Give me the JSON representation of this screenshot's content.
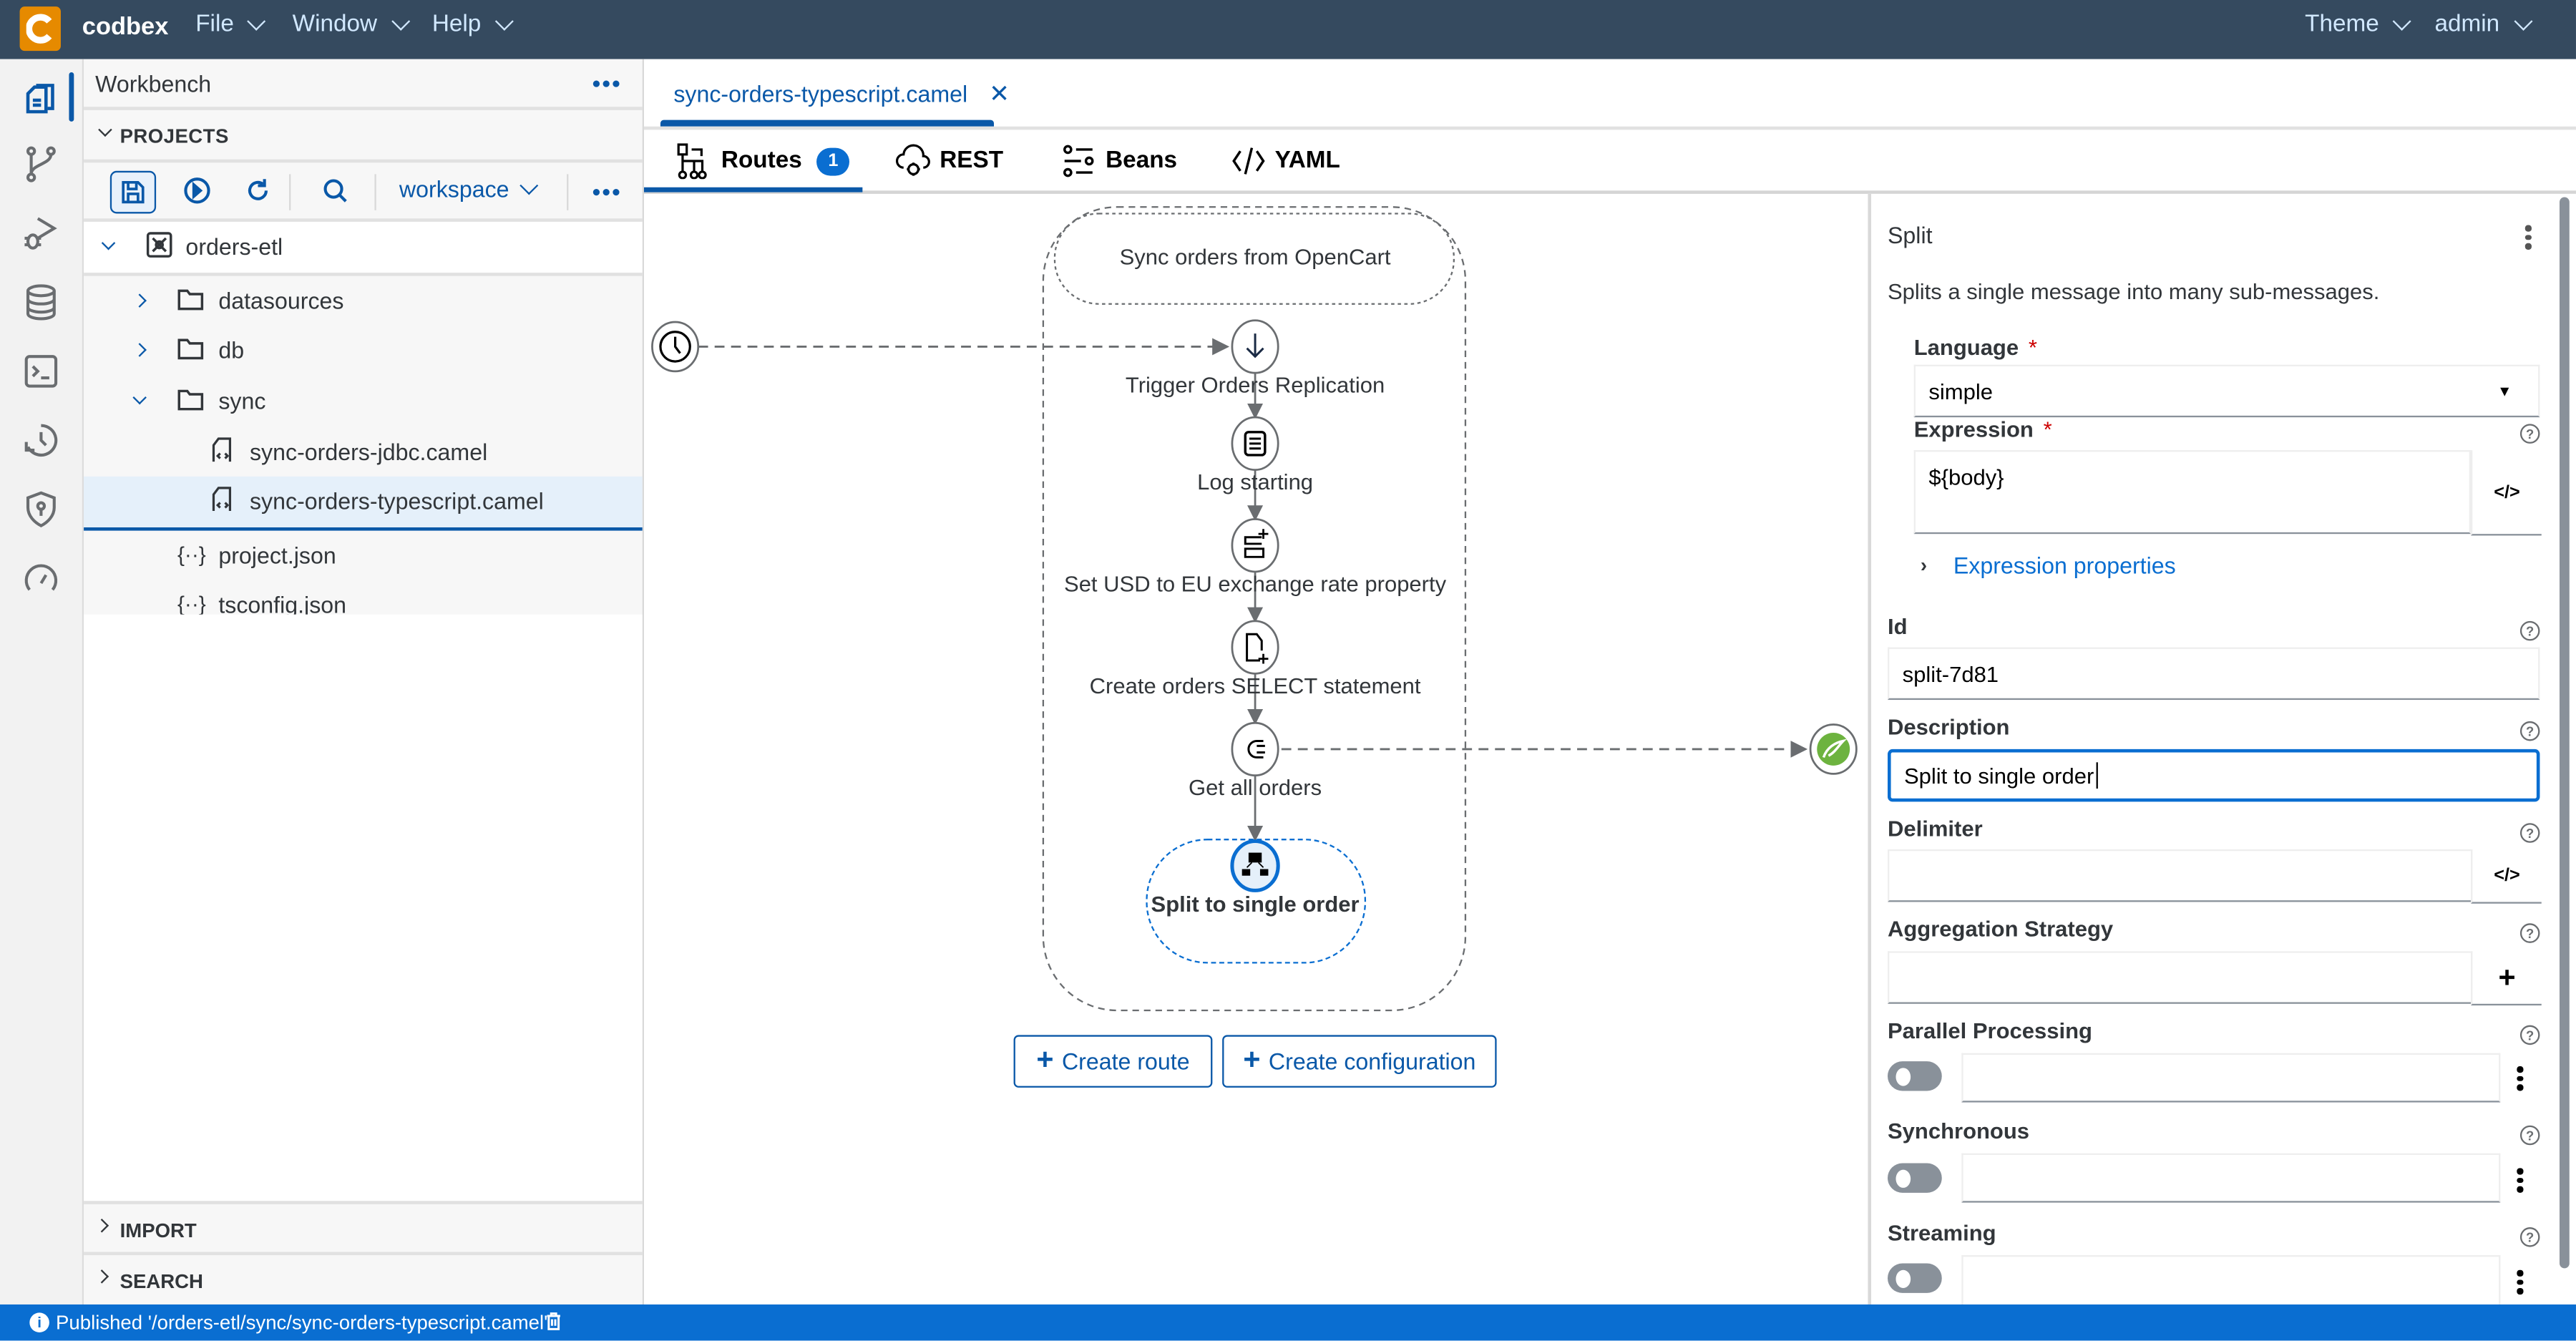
{
  "app": {
    "brand": "codbex",
    "menus": [
      "File",
      "Window",
      "Help"
    ],
    "right_menus": [
      "Theme",
      "admin"
    ]
  },
  "activity_bar": {
    "items": [
      {
        "icon": "documents-icon",
        "active": true
      },
      {
        "icon": "git-branch-icon"
      },
      {
        "icon": "debug-icon"
      },
      {
        "icon": "database-icon"
      },
      {
        "icon": "terminal-icon"
      },
      {
        "icon": "history-icon"
      },
      {
        "icon": "shield-icon"
      },
      {
        "icon": "gauge-icon"
      }
    ]
  },
  "sidebar": {
    "title": "Workbench",
    "projects_label": "PROJECTS",
    "workspace": "workspace",
    "tree": [
      {
        "name": "orders-etl",
        "type": "project",
        "expanded": true,
        "level": 0
      },
      {
        "name": "datasources",
        "type": "folder",
        "expanded": false,
        "level": 1
      },
      {
        "name": "db",
        "type": "folder",
        "expanded": false,
        "level": 1
      },
      {
        "name": "sync",
        "type": "folder",
        "expanded": true,
        "level": 1
      },
      {
        "name": "sync-orders-jdbc.camel",
        "type": "camel",
        "level": 2
      },
      {
        "name": "sync-orders-typescript.camel",
        "type": "camel",
        "level": 2,
        "selected": true
      },
      {
        "name": "project.json",
        "type": "json",
        "level": 1
      },
      {
        "name": "tsconfig.json",
        "type": "json",
        "level": 1
      }
    ],
    "import_label": "IMPORT",
    "search_label": "SEARCH"
  },
  "editor": {
    "file_tab": "sync-orders-typescript.camel",
    "subtabs": [
      {
        "label": "Routes",
        "badge": "1",
        "icon": "routes-icon"
      },
      {
        "label": "REST",
        "icon": "rest-cloud-icon"
      },
      {
        "label": "Beans",
        "icon": "beans-icon"
      },
      {
        "label": "YAML",
        "icon": "code-icon"
      }
    ]
  },
  "route": {
    "title": "Sync orders from OpenCart",
    "steps": [
      {
        "label": "Trigger Orders Replication",
        "icon": "arrow-down-icon"
      },
      {
        "label": "Log starting",
        "icon": "log-icon"
      },
      {
        "label": "Set USD to EU exchange rate property",
        "icon": "set-property-icon"
      },
      {
        "label": "Create orders SELECT statement",
        "icon": "new-document-icon"
      },
      {
        "label": "Get all orders",
        "icon": "plug-icon"
      },
      {
        "label": "Split to single order",
        "icon": "split-icon",
        "selected": true
      }
    ],
    "create_route": "Create route",
    "create_configuration": "Create configuration"
  },
  "properties": {
    "title": "Split",
    "description": "Splits a single message into many sub-messages.",
    "language_label": "Language",
    "language_value": "simple",
    "expression_label": "Expression",
    "expression_value": "${body}",
    "expression_properties": "Expression properties",
    "id_label": "Id",
    "id_value": "split-7d81",
    "description_label": "Description",
    "description_value": "Split to single order",
    "delimiter_label": "Delimiter",
    "delimiter_value": "",
    "aggregation_label": "Aggregation Strategy",
    "parallel_label": "Parallel Processing",
    "parallel_on": false,
    "synchronous_label": "Synchronous",
    "synchronous_on": false,
    "streaming_label": "Streaming",
    "streaming_on": false
  },
  "status": {
    "message": "Published '/orders-etl/sync/sync-orders-typescript.camel'"
  }
}
